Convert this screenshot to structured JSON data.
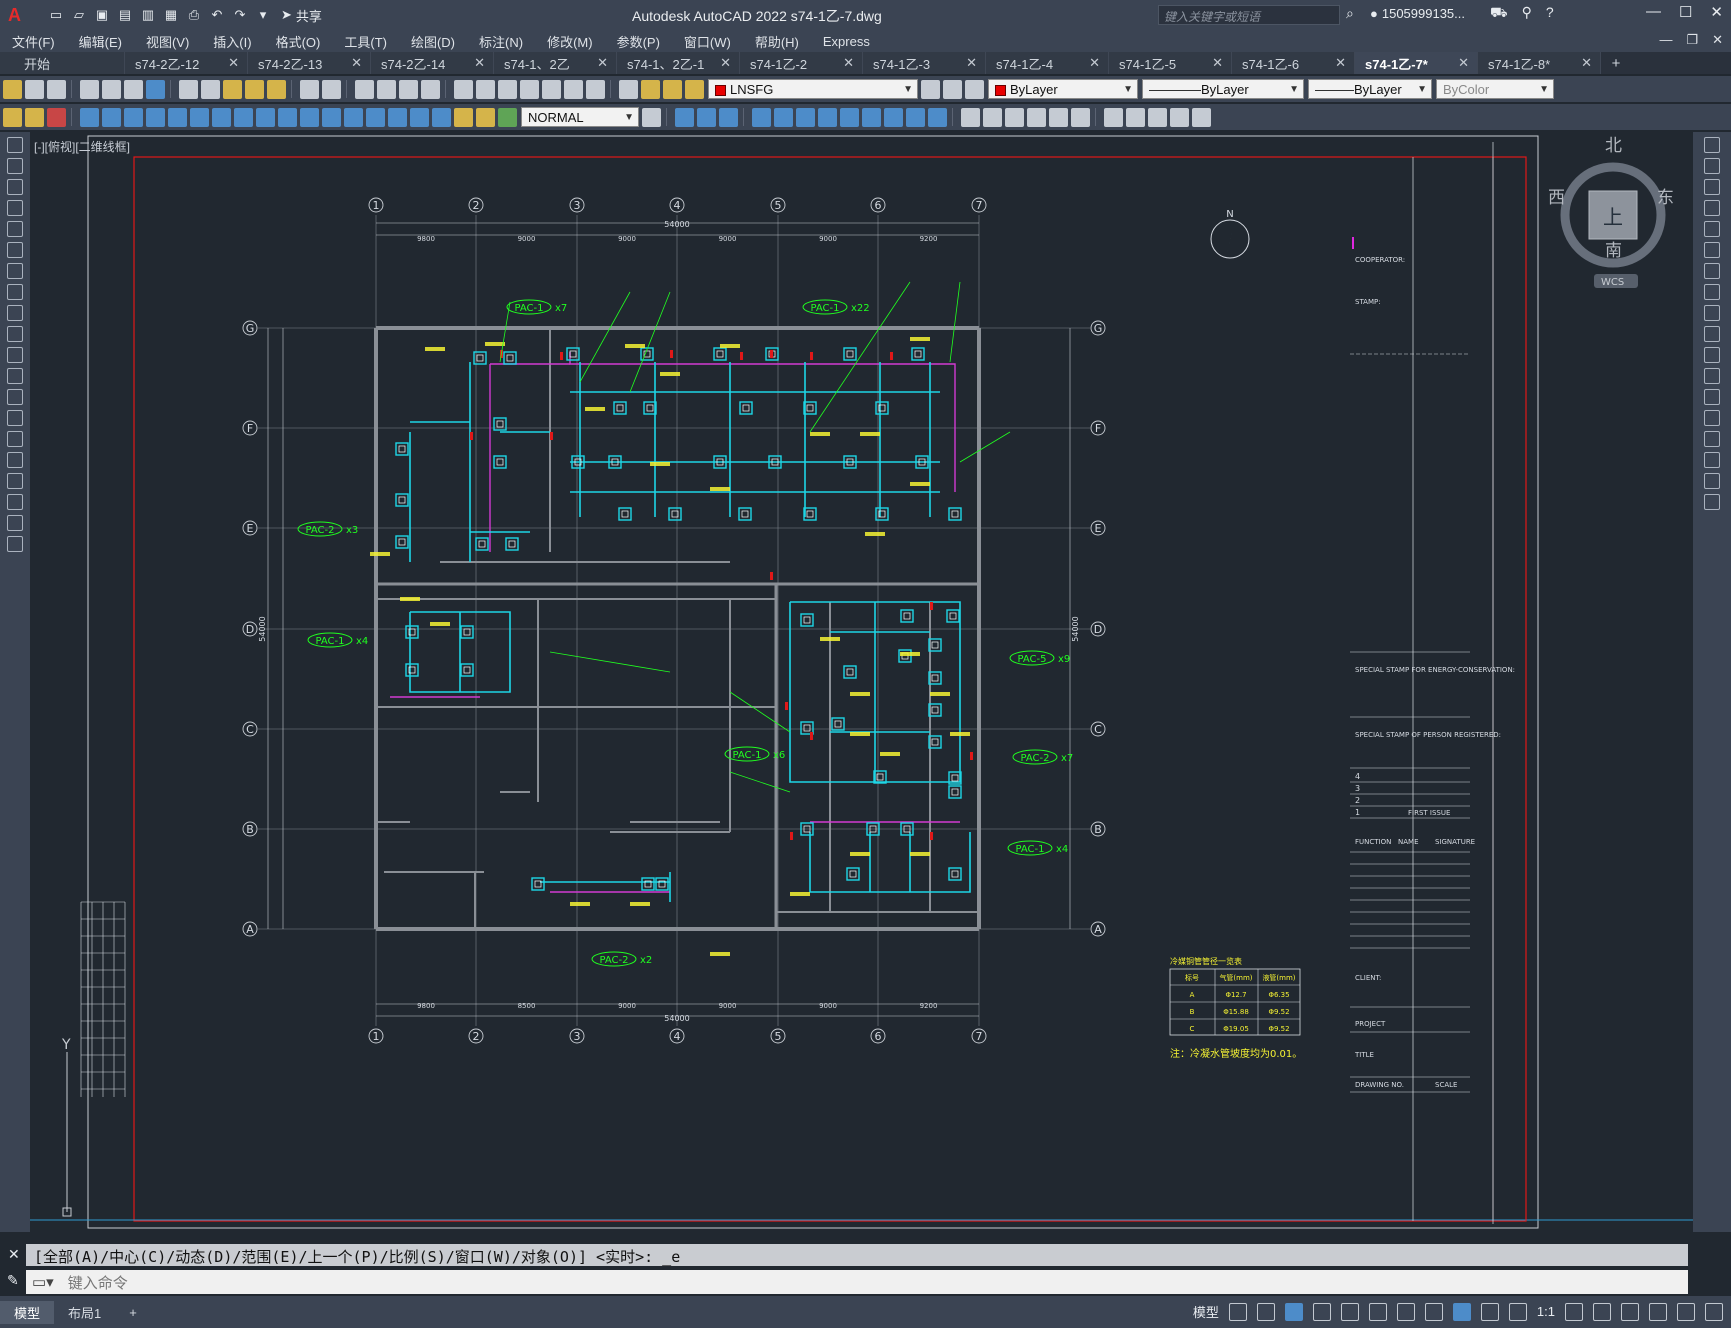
{
  "app": {
    "title": "Autodesk AutoCAD 2022    s74-1乙-7.dwg",
    "share_label": "共享",
    "search_placeholder": "键入关键字或短语",
    "user_name": "1505999135..."
  },
  "menu": [
    "文件(F)",
    "编辑(E)",
    "视图(V)",
    "插入(I)",
    "格式(O)",
    "工具(T)",
    "绘图(D)",
    "标注(N)",
    "修改(M)",
    "参数(P)",
    "窗口(W)",
    "帮助(H)",
    "Express"
  ],
  "tabs": [
    {
      "label": "开始",
      "closable": false,
      "active": false
    },
    {
      "label": "s74-2乙-12",
      "closable": true,
      "active": false
    },
    {
      "label": "s74-2乙-13",
      "closable": true,
      "active": false
    },
    {
      "label": "s74-2乙-14",
      "closable": true,
      "active": false
    },
    {
      "label": "s74-1、2乙",
      "closable": true,
      "active": false
    },
    {
      "label": "s74-1、2乙-1",
      "closable": true,
      "active": false
    },
    {
      "label": "s74-1乙-2",
      "closable": true,
      "active": false
    },
    {
      "label": "s74-1乙-3",
      "closable": true,
      "active": false
    },
    {
      "label": "s74-1乙-4",
      "closable": true,
      "active": false
    },
    {
      "label": "s74-1乙-5",
      "closable": true,
      "active": false
    },
    {
      "label": "s74-1乙-6",
      "closable": true,
      "active": false
    },
    {
      "label": "s74-1乙-7*",
      "closable": true,
      "active": true
    },
    {
      "label": "s74-1乙-8*",
      "closable": true,
      "active": false
    }
  ],
  "properties": {
    "layer": "LNSFG",
    "color": "ByLayer",
    "linetype": "ByLayer",
    "lineweight": "ByLayer",
    "plotstyle": "ByColor",
    "dimstyle": "NORMAL"
  },
  "viewport_label": "[-][俯视][二维线框]",
  "viewcube": {
    "north": "北",
    "south": "南",
    "east": "东",
    "west": "西",
    "face": "上",
    "wcs": "WCS"
  },
  "drawing": {
    "axis_numbers": [
      "1",
      "2",
      "3",
      "4",
      "5",
      "6",
      "7"
    ],
    "axis_letters": [
      "A",
      "B",
      "C",
      "D",
      "E",
      "F",
      "G"
    ],
    "top_dims": [
      "9800",
      "9000",
      "9000",
      "9000",
      "9000",
      "9200"
    ],
    "top_total": "54000",
    "bottom_dims": [
      "9800",
      "8500",
      "9000",
      "9000",
      "9000",
      "9200"
    ],
    "bottom_total": "54000",
    "left_total": "54000",
    "right_total": "54000",
    "north": "N",
    "pac_tags": [
      {
        "text": "PAC-1",
        "count": "x7"
      },
      {
        "text": "PAC-1",
        "count": "x22"
      },
      {
        "text": "PAC-2",
        "count": "x3"
      },
      {
        "text": "PAC-1",
        "count": "x4"
      },
      {
        "text": "PAC-1",
        "count": "x6"
      },
      {
        "text": "PAC-5",
        "count": "x9"
      },
      {
        "text": "PAC-2",
        "count": "x7"
      },
      {
        "text": "PAC-1",
        "count": "x4"
      },
      {
        "text": "PAC-2",
        "count": "x2"
      }
    ],
    "legend_title": "冷媒铜管管径一览表",
    "legend_headers": [
      "标号",
      "气管(mm)",
      "液管(mm)"
    ],
    "legend_rows": [
      [
        "A",
        "Φ12.7",
        "Φ6.35"
      ],
      [
        "B",
        "Φ15.88",
        "Φ9.52"
      ],
      [
        "C",
        "Φ19.05",
        "Φ9.52"
      ]
    ],
    "note": "注：冷凝水管坡度均为0.01。",
    "titleblock": {
      "cooperator": "COOPERATOR:",
      "stamp": "STAMP:",
      "energy": "SPECIAL STAMP\nFOR ENERGY-CONSERVATION:",
      "registered": "SPECIAL STAMP\nOF PERSON REGISTERED:",
      "revisions": [
        "4",
        "3",
        "2",
        "1"
      ],
      "first_issue": "FIRST ISSUE",
      "function": "FUNCTION",
      "name": "NAME",
      "signature": "SIGNATURE",
      "client": "CLIENT:",
      "project": "PROJECT",
      "title": "TITLE",
      "drawing_no": "DRAWING NO.",
      "scale": "SCALE"
    }
  },
  "command": {
    "history": "[全部(A)/中心(C)/动态(D)/范围(E)/上一个(P)/比例(S)/窗口(W)/对象(O)] <实时>: _e",
    "placeholder": "键入命令"
  },
  "status": {
    "tabs": [
      "模型",
      "布局1"
    ],
    "model_label": "模型",
    "scale": "1:1"
  },
  "colors": {
    "background": "#212830",
    "ui": "#3b4453",
    "frame_red": "#e01818",
    "pipe_cyan": "#1ed6e6",
    "pipe_magenta": "#d23ad2",
    "text_yellow": "#f5f233",
    "text_green": "#20ff20",
    "wall": "#8a8f96"
  }
}
